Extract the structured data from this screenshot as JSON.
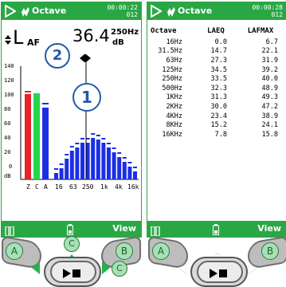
{
  "left_screen": {
    "app_title": "Octave",
    "clock_line1": "00:00:22",
    "clock_line2": "012",
    "measure_label": "L",
    "measure_sub": "AF",
    "measure_value": "36.4",
    "measure_freq": "250Hz",
    "measure_unit": "dB",
    "y_ticks": [
      "140",
      "120",
      "100",
      "80",
      "60",
      "40",
      "20",
      "0"
    ],
    "y_unit": "dB",
    "x_labels": [
      "Z",
      "C",
      "A",
      "16",
      "63",
      "250",
      "1k",
      "4k",
      "16k"
    ],
    "callout_1": "1",
    "callout_2": "2",
    "view_label": "View"
  },
  "right_screen": {
    "app_title": "Octave",
    "clock_line1": "00:00:28",
    "clock_line2": "012",
    "columns": [
      "Octave",
      "LAEQ",
      "LAFMAX"
    ],
    "rows": [
      [
        "16Hz",
        "0.0",
        "6.7"
      ],
      [
        "31.5Hz",
        "14.7",
        "22.1"
      ],
      [
        "63Hz",
        "27.3",
        "31.9"
      ],
      [
        "125Hz",
        "34.5",
        "39.2"
      ],
      [
        "250Hz",
        "33.5",
        "40.0"
      ],
      [
        "500Hz",
        "32.3",
        "48.9"
      ],
      [
        "1KHz",
        "31.3",
        "49.3"
      ],
      [
        "2KHz",
        "30.0",
        "47.2"
      ],
      [
        "4KHz",
        "23.4",
        "38.9"
      ],
      [
        "8KHz",
        "15.2",
        "24.1"
      ],
      [
        "16KHz",
        "7.8",
        "15.8"
      ]
    ],
    "view_label": "View"
  },
  "buttons": {
    "a_label": "A",
    "b_label": "B",
    "c_label": "C",
    "a_label_right": "A",
    "b_label_right": "B"
  },
  "colors": {
    "accent": "#2aa745",
    "bar_blue": "#1b2ee6",
    "bar_red": "#e8222b",
    "bar_green": "#25d64b",
    "callout": "#1f5ca8"
  }
}
